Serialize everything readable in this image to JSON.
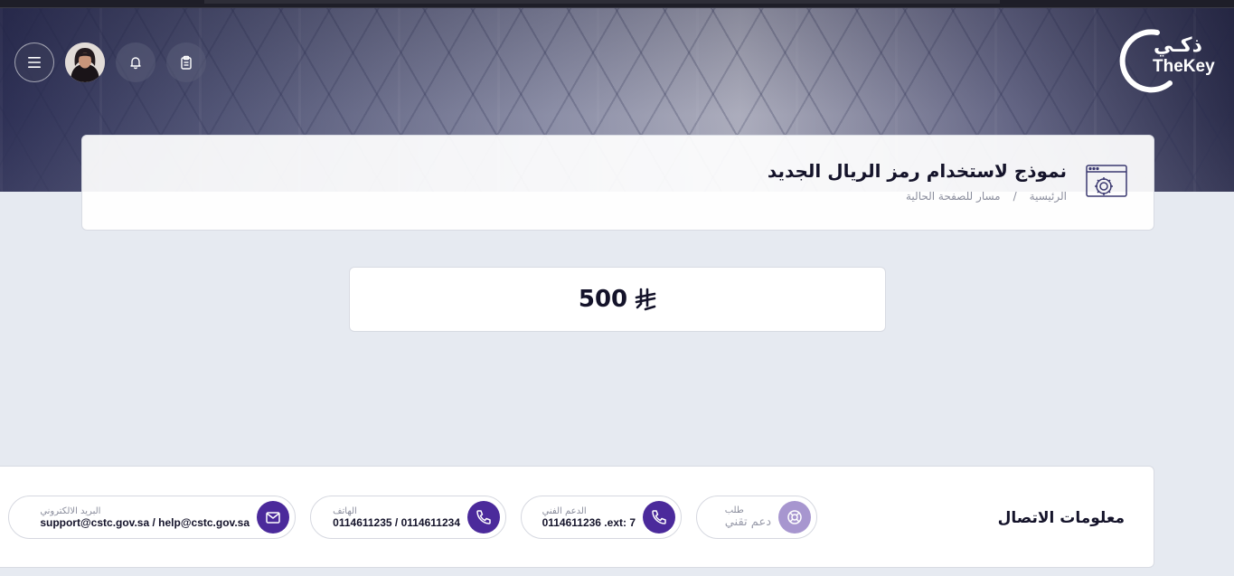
{
  "header": {
    "logo": {
      "arabic": "ذكـي",
      "english": "TheKey"
    },
    "menu_icon": "hamburger-icon",
    "notifications_icon": "bell-icon",
    "tasks_icon": "clipboard-icon"
  },
  "page": {
    "title": "نموذج لاستخدام رمز الريال الجديد",
    "breadcrumb": {
      "home": "الرئيسية",
      "separator": "/",
      "current": "مسار للصفحة الحالية"
    },
    "icon": "settings-window-icon"
  },
  "amount": {
    "value": "500",
    "currency_icon": "saudi-riyal-icon"
  },
  "contact": {
    "title": "معلومات الاتصال",
    "items": [
      {
        "label": "طلب",
        "value": "دعم تقني",
        "icon": "lifebuoy-icon"
      },
      {
        "label": "الدعم الفني",
        "value": "0114611236 .ext: 7",
        "icon": "phone-icon"
      },
      {
        "label": "الهاتف",
        "value": "0114611235 / 0114611234",
        "icon": "phone-icon"
      },
      {
        "label": "البريد الالكتروني",
        "value": "support@cstc.gov.sa / help@cstc.gov.sa",
        "icon": "mail-icon"
      }
    ]
  },
  "colors": {
    "accent": "#4b2a9b",
    "accent_muted": "#a796cf",
    "page_bg": "#e6eaf1"
  }
}
